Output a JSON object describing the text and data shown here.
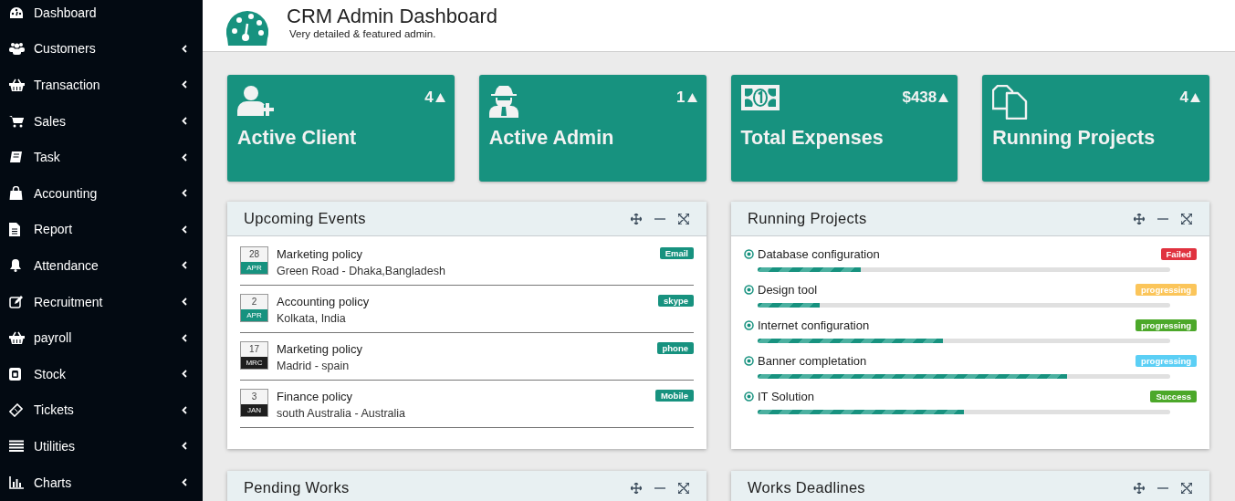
{
  "sidebar": {
    "items": [
      {
        "label": "Dashboard",
        "expandable": false
      },
      {
        "label": "Customers",
        "expandable": true
      },
      {
        "label": "Transaction",
        "expandable": true
      },
      {
        "label": "Sales",
        "expandable": true
      },
      {
        "label": "Task",
        "expandable": true
      },
      {
        "label": "Accounting",
        "expandable": true
      },
      {
        "label": "Report",
        "expandable": true
      },
      {
        "label": "Attendance",
        "expandable": true
      },
      {
        "label": "Recruitment",
        "expandable": true
      },
      {
        "label": "payroll",
        "expandable": true
      },
      {
        "label": "Stock",
        "expandable": true
      },
      {
        "label": "Tickets",
        "expandable": true
      },
      {
        "label": "Utilities",
        "expandable": true
      },
      {
        "label": "Charts",
        "expandable": true
      }
    ]
  },
  "header": {
    "title": "CRM Admin Dashboard",
    "subtitle": "Very detailed & featured admin."
  },
  "stat_cards": [
    {
      "label": "Active Client",
      "value": "4"
    },
    {
      "label": "Active Admin",
      "value": "1"
    },
    {
      "label": "Total Expenses",
      "value": "$438"
    },
    {
      "label": "Running Projects",
      "value": "4"
    }
  ],
  "upcoming_events": {
    "title": "Upcoming Events",
    "events": [
      {
        "day": "28",
        "month": "APR",
        "color": "#17927f",
        "title": "Marketing policy",
        "place": "Green Road - Dhaka,Bangladesh",
        "tag": "Email"
      },
      {
        "day": "2",
        "month": "APR",
        "color": "#17927f",
        "title": "Accounting policy",
        "place": "Kolkata, India",
        "tag": "skype"
      },
      {
        "day": "17",
        "month": "MRC",
        "color": "#1e1e1e",
        "title": "Marketing policy",
        "place": "Madrid - spain",
        "tag": "phone"
      },
      {
        "day": "3",
        "month": "JAN",
        "color": "#1e1e1e",
        "title": "Finance policy",
        "place": "south Australia - Australia",
        "tag": "Mobile"
      }
    ]
  },
  "running_projects": {
    "title": "Running Projects",
    "projects": [
      {
        "name": "Database configuration",
        "status": "Failed",
        "color": "#e0323f",
        "level": 0.25
      },
      {
        "name": "Design tool",
        "status": "progressing",
        "color": "#fbc55a",
        "level": 0.15
      },
      {
        "name": "Internet configuration",
        "status": "progressing",
        "color": "#4ca82a",
        "level": 0.45
      },
      {
        "name": "Banner completation",
        "status": "progressing",
        "color": "#5bcff5",
        "level": 0.75
      },
      {
        "name": "IT Solution",
        "status": "Success",
        "color": "#4ca82a",
        "level": 0.5
      }
    ]
  },
  "bottom_panels": [
    {
      "title": "Pending Works"
    },
    {
      "title": "Works Deadlines"
    }
  ]
}
